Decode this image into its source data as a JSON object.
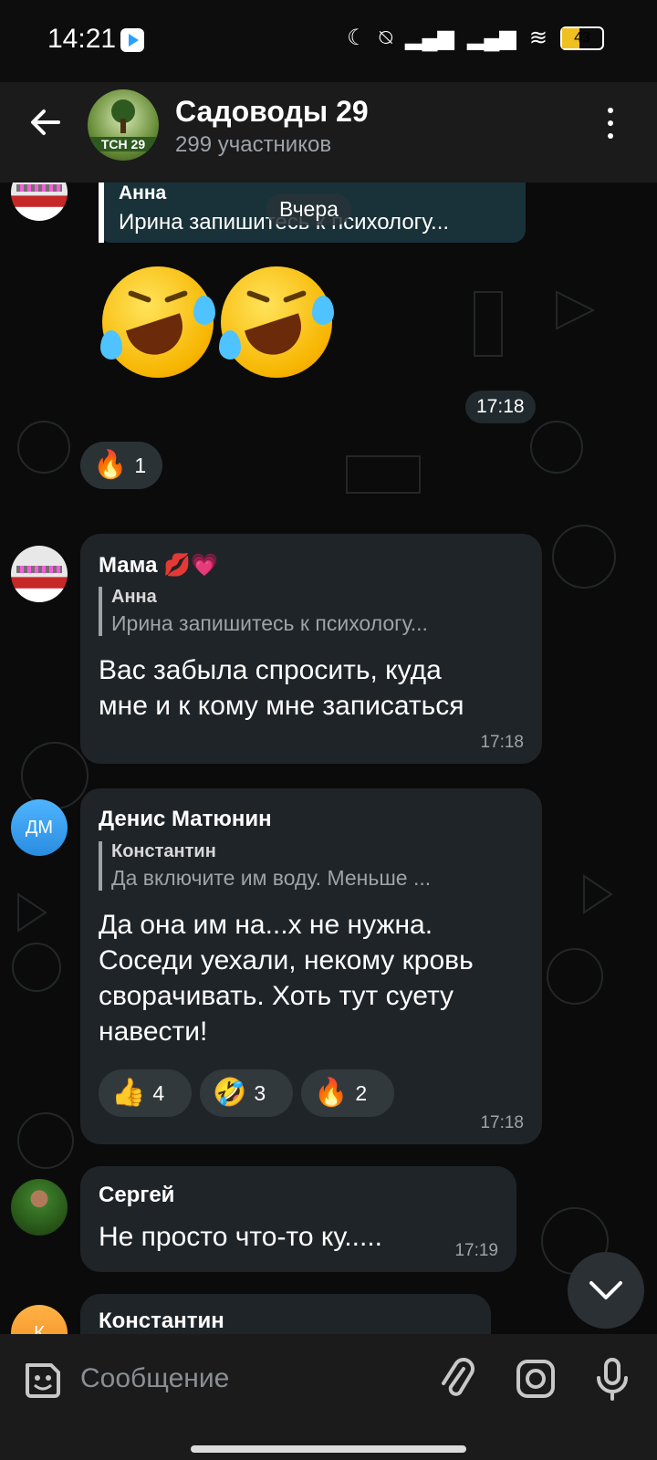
{
  "status_bar": {
    "time": "14:21",
    "battery": "43"
  },
  "header": {
    "title": "Садоводы 29",
    "subtitle": "299 участников",
    "avatar_text": "ТСН 29"
  },
  "chat": {
    "date_label": "Вчера",
    "top_reply": {
      "name": "Анна",
      "text": "Ирина запишитесь к психологу..."
    },
    "sticker_message": {
      "emojis": [
        "rolling-on-floor-laughing",
        "rolling-on-floor-laughing"
      ],
      "time": "17:18",
      "reaction": {
        "icon": "🔥",
        "count": "1"
      }
    },
    "messages": [
      {
        "author": "Мама 💋💗",
        "reply_name": "Анна",
        "reply_text": "Ирина запишитесь к психологу...",
        "text_lines": [
          "Вас забыла спросить, куда",
          "мне и к кому мне записаться"
        ],
        "time": "17:18"
      },
      {
        "author": "Денис Матюнин",
        "avatar_initials": "ДМ",
        "reply_name": "Константин",
        "reply_text": "Да включите им воду. Меньше ...",
        "text_lines": [
          "Да она им на...х не нужна.",
          "Соседи уехали, некому кровь",
          "сворачивать. Хоть тут суету",
          "навести!"
        ],
        "reactions": [
          {
            "icon": "👍",
            "count": "4"
          },
          {
            "icon": "🤣",
            "count": "3"
          },
          {
            "icon": "🔥",
            "count": "2"
          }
        ],
        "time": "17:18"
      },
      {
        "author": "Сергей",
        "text": "Не просто что-то ку.....",
        "time": "17:19"
      },
      {
        "author": "Константин",
        "avatar_initials": "К"
      }
    ]
  },
  "input": {
    "placeholder": "Сообщение"
  },
  "colors": {
    "bubble": "#1f2428",
    "header": "#1b1b1b",
    "accent_blue": "#4fb5ff"
  }
}
